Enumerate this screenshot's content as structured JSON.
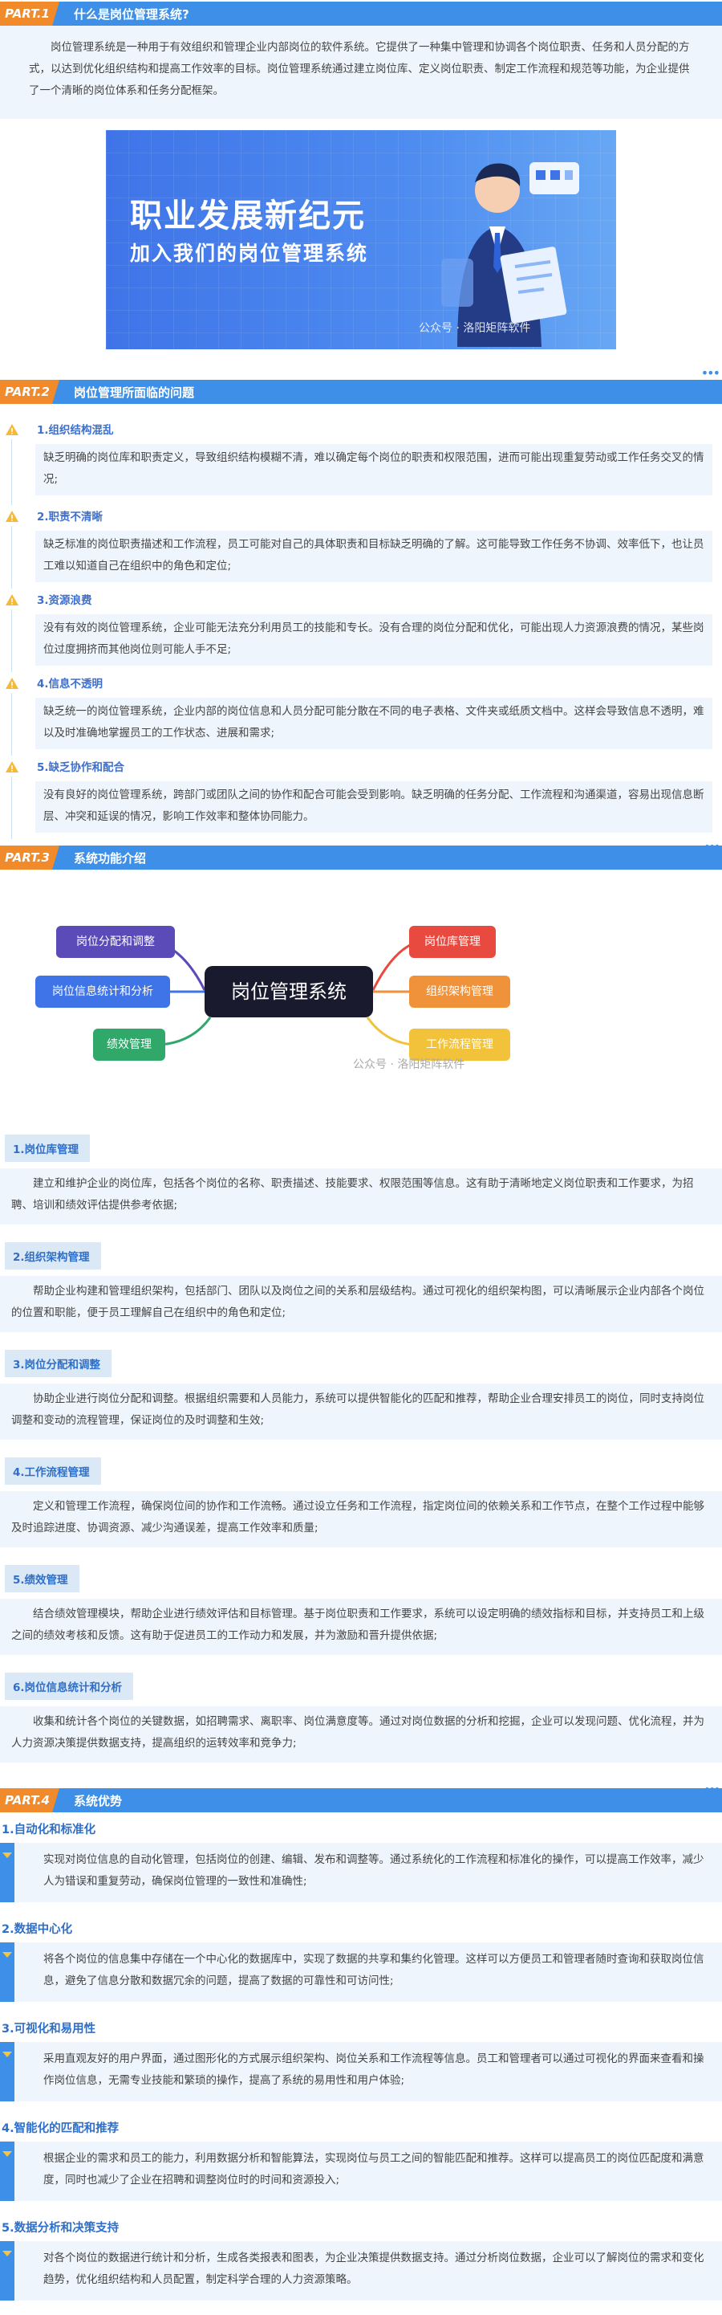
{
  "section1": {
    "part": "PART.1",
    "title": "什么是岗位管理系统?",
    "body": "岗位管理系统是一种用于有效组织和管理企业内部岗位的软件系统。它提供了一种集中管理和协调各个岗位职责、任务和人员分配的方式，以达到优化组织结构和提高工作效率的目标。岗位管理系统通过建立岗位库、定义岗位职责、制定工作流程和规范等功能，为企业提供了一个清晰的岗位体系和任务分配框架。",
    "banner": {
      "line1": "职业发展新纪元",
      "line2": "加入我们的岗位管理系统",
      "watermark": "公众号 · 洛阳矩阵软件"
    }
  },
  "section2": {
    "part": "PART.2",
    "title": "岗位管理所面临的问题",
    "issues": [
      {
        "name": "1.组织结构混乱",
        "desc": "缺乏明确的岗位库和职责定义，导致组织结构模糊不清，难以确定每个岗位的职责和权限范围，进而可能出现重复劳动或工作任务交叉的情况;"
      },
      {
        "name": "2.职责不清晰",
        "desc": "缺乏标准的岗位职责描述和工作流程，员工可能对自己的具体职责和目标缺乏明确的了解。这可能导致工作任务不协调、效率低下，也让员工难以知道自己在组织中的角色和定位;"
      },
      {
        "name": "3.资源浪费",
        "desc": "没有有效的岗位管理系统，企业可能无法充分利用员工的技能和专长。没有合理的岗位分配和优化，可能出现人力资源浪费的情况，某些岗位过度拥挤而其他岗位则可能人手不足;"
      },
      {
        "name": "4.信息不透明",
        "desc": "缺乏统一的岗位管理系统，企业内部的岗位信息和人员分配可能分散在不同的电子表格、文件夹或纸质文档中。这样会导致信息不透明，难以及时准确地掌握员工的工作状态、进展和需求;"
      },
      {
        "name": "5.缺乏协作和配合",
        "desc": "没有良好的岗位管理系统，跨部门或团队之间的协作和配合可能会受到影响。缺乏明确的任务分配、工作流程和沟通渠道，容易出现信息断层、冲突和延误的情况，影响工作效率和整体协同能力。"
      }
    ]
  },
  "section3": {
    "part": "PART.3",
    "title": "系统功能介绍",
    "mindmap": {
      "center": "岗位管理系统",
      "left": [
        "岗位分配和调整",
        "岗位信息统计和分析",
        "绩效管理"
      ],
      "right": [
        "岗位库管理",
        "组织架构管理",
        "工作流程管理"
      ],
      "watermark": "公众号 · 洛阳矩阵软件",
      "colors": {
        "left0": "#5b4bb8",
        "left1": "#3f74e8",
        "left2": "#2fa86a",
        "right0": "#e84a3f",
        "right1": "#f0923a",
        "right2": "#f2c23a"
      }
    },
    "functions": [
      {
        "label": "1.岗位库管理",
        "desc": "建立和维护企业的岗位库，包括各个岗位的名称、职责描述、技能要求、权限范围等信息。这有助于清晰地定义岗位职责和工作要求，为招聘、培训和绩效评估提供参考依据;"
      },
      {
        "label": "2.组织架构管理",
        "desc": "帮助企业构建和管理组织架构，包括部门、团队以及岗位之间的关系和层级结构。通过可视化的组织架构图，可以清晰展示企业内部各个岗位的位置和职能，便于员工理解自己在组织中的角色和定位;"
      },
      {
        "label": "3.岗位分配和调整",
        "desc": "协助企业进行岗位分配和调整。根据组织需要和人员能力，系统可以提供智能化的匹配和推荐，帮助企业合理安排员工的岗位，同时支持岗位调整和变动的流程管理，保证岗位的及时调整和生效;"
      },
      {
        "label": "4.工作流程管理",
        "desc": "定义和管理工作流程，确保岗位间的协作和工作流畅。通过设立任务和工作流程，指定岗位间的依赖关系和工作节点，在整个工作过程中能够及时追踪进度、协调资源、减少沟通误差，提高工作效率和质量;"
      },
      {
        "label": "5.绩效管理",
        "desc": "结合绩效管理模块，帮助企业进行绩效评估和目标管理。基于岗位职责和工作要求，系统可以设定明确的绩效指标和目标，并支持员工和上级之间的绩效考核和反馈。这有助于促进员工的工作动力和发展，并为激励和晋升提供依据;"
      },
      {
        "label": "6.岗位信息统计和分析",
        "desc": "收集和统计各个岗位的关键数据，如招聘需求、离职率、岗位满意度等。通过对岗位数据的分析和挖掘，企业可以发现问题、优化流程，并为人力资源决策提供数据支持，提高组织的运转效率和竞争力;"
      }
    ]
  },
  "section4": {
    "part": "PART.4",
    "title": "系统优势",
    "items": [
      {
        "head": "1.自动化和标准化",
        "desc": "实现对岗位信息的自动化管理，包括岗位的创建、编辑、发布和调整等。通过系统化的工作流程和标准化的操作，可以提高工作效率，减少人为错误和重复劳动，确保岗位管理的一致性和准确性;"
      },
      {
        "head": "2.数据中心化",
        "desc": "将各个岗位的信息集中存储在一个中心化的数据库中，实现了数据的共享和集约化管理。这样可以方便员工和管理者随时查询和获取岗位信息，避免了信息分散和数据冗余的问题，提高了数据的可靠性和可访问性;"
      },
      {
        "head": "3.可视化和易用性",
        "desc": "采用直观友好的用户界面，通过图形化的方式展示组织架构、岗位关系和工作流程等信息。员工和管理者可以通过可视化的界面来查看和操作岗位信息，无需专业技能和繁琐的操作，提高了系统的易用性和用户体验;"
      },
      {
        "head": "4.智能化的匹配和推荐",
        "desc": "根据企业的需求和员工的能力，利用数据分析和智能算法，实现岗位与员工之间的智能匹配和推荐。这样可以提高员工的岗位匹配度和满意度，同时也减少了企业在招聘和调整岗位时的时间和资源投入;"
      },
      {
        "head": "5.数据分析和决策支持",
        "desc": "对各个岗位的数据进行统计和分析，生成各类报表和图表，为企业决策提供数据支持。通过分析岗位数据，企业可以了解岗位的需求和变化趋势，优化组织结构和人员配置，制定科学合理的人力资源策略。"
      }
    ]
  }
}
